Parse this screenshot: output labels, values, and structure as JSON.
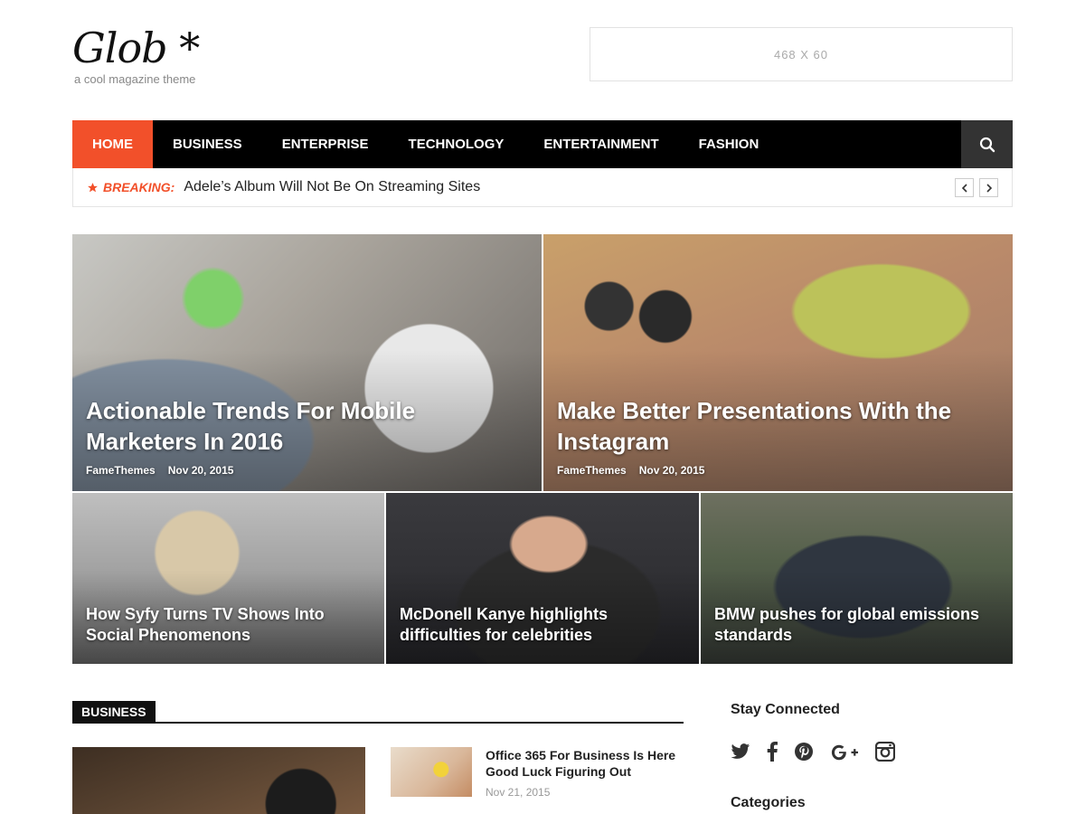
{
  "site": {
    "title": "Glob *",
    "tagline": "a cool magazine theme",
    "ad_text": "468 X 60"
  },
  "nav": {
    "items": [
      "HOME",
      "BUSINESS",
      "ENTERPRISE",
      "TECHNOLOGY",
      "ENTERTAINMENT",
      "FASHION"
    ],
    "active": "HOME",
    "search_icon": "search-icon"
  },
  "breaking": {
    "label": "BREAKING:",
    "headline": "Adele’s Album Will Not Be On Streaming Sites",
    "prev_icon": "chevron-left-icon",
    "next_icon": "chevron-right-icon"
  },
  "featured": [
    {
      "title": "Actionable Trends For Mobile Marketers In 2016",
      "author": "FameThemes",
      "date": "Nov 20, 2015"
    },
    {
      "title": "Make Better Presentations With the Instagram",
      "author": "FameThemes",
      "date": "Nov 20, 2015"
    },
    {
      "title": "How Syfy Turns TV Shows Into Social Phenomenons"
    },
    {
      "title": "McDonell Kanye highlights difficulties for celebrities"
    },
    {
      "title": "BMW pushes for global emissions standards"
    }
  ],
  "business": {
    "label": "BUSINESS",
    "items": [
      {
        "title": "Office 365 For Business Is Here Good Luck Figuring Out",
        "date": "Nov 21, 2015"
      }
    ]
  },
  "sidebar": {
    "stay_connected": "Stay Connected",
    "social_icons": [
      "twitter-icon",
      "facebook-icon",
      "pinterest-icon",
      "google-plus-icon",
      "instagram-icon"
    ],
    "categories": "Categories"
  },
  "colors": {
    "accent": "#f2502a",
    "nav_bg": "#000000",
    "search_bg": "#333333"
  }
}
